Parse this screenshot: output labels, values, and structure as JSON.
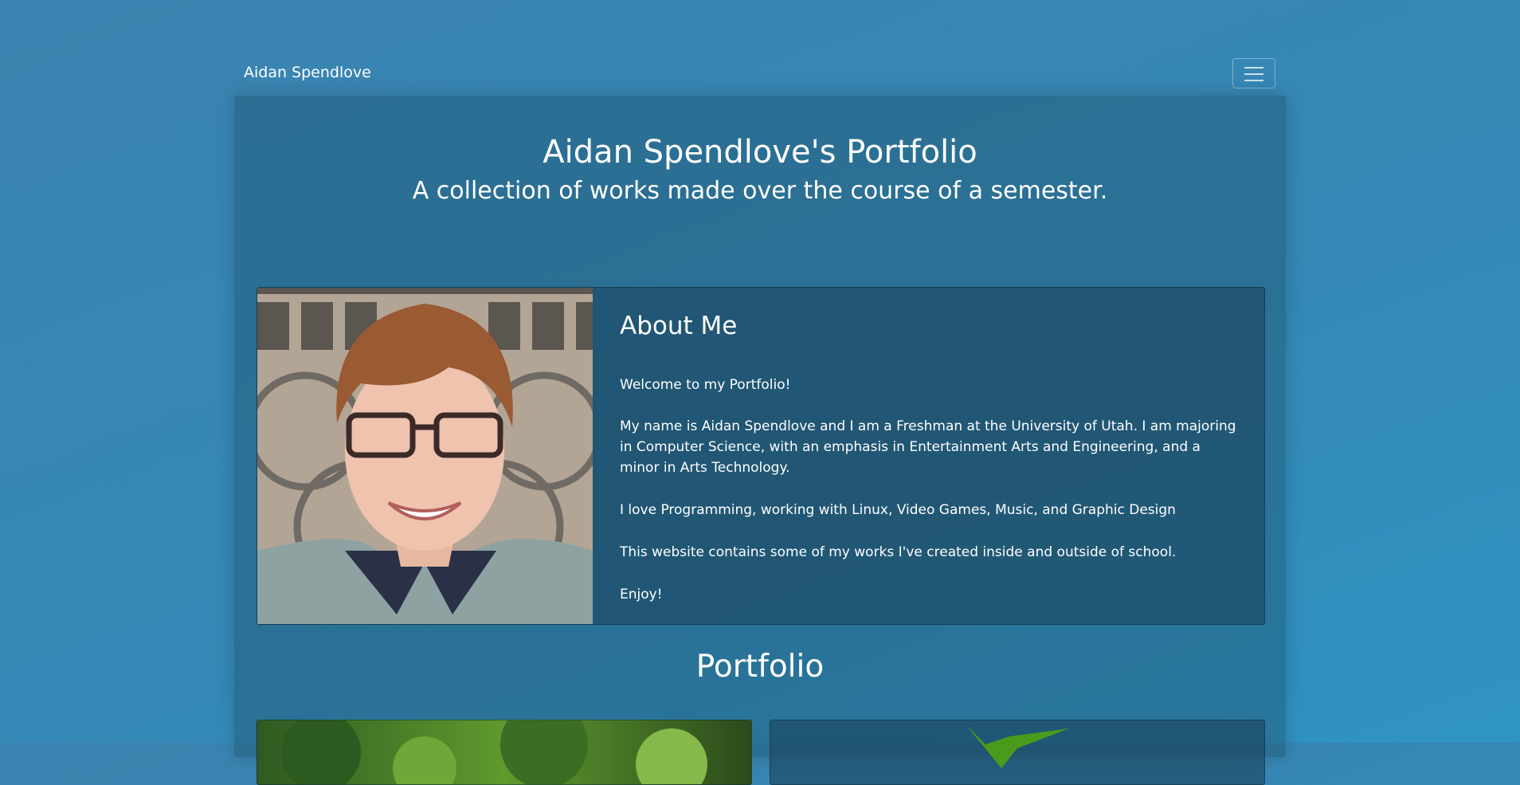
{
  "navbar": {
    "brand": "Aidan Spendlove",
    "menu_icon": "hamburger-menu-icon"
  },
  "hero": {
    "title": "Aidan Spendlove's Portfolio",
    "subtitle": "A collection of works made over the course of a semester."
  },
  "about": {
    "title": "About Me",
    "paragraphs": [
      "Welcome to my Portfolio!",
      "My name is Aidan Spendlove and I am a Freshman at the University of Utah. I am majoring in Computer Science, with an emphasis in Entertainment Arts and Engineering, and a minor in Arts Technology.",
      "I love Programming, working with Linux, Video Games, Music, and Graphic Design",
      "This website contains some of my works I've created inside and outside of school.",
      "Enjoy!"
    ]
  },
  "portfolio": {
    "title": "Portfolio"
  },
  "colors": {
    "background": "#3a83b0",
    "panel": "#2b6a8c",
    "card": "#24566f",
    "text": "#ffffff"
  }
}
